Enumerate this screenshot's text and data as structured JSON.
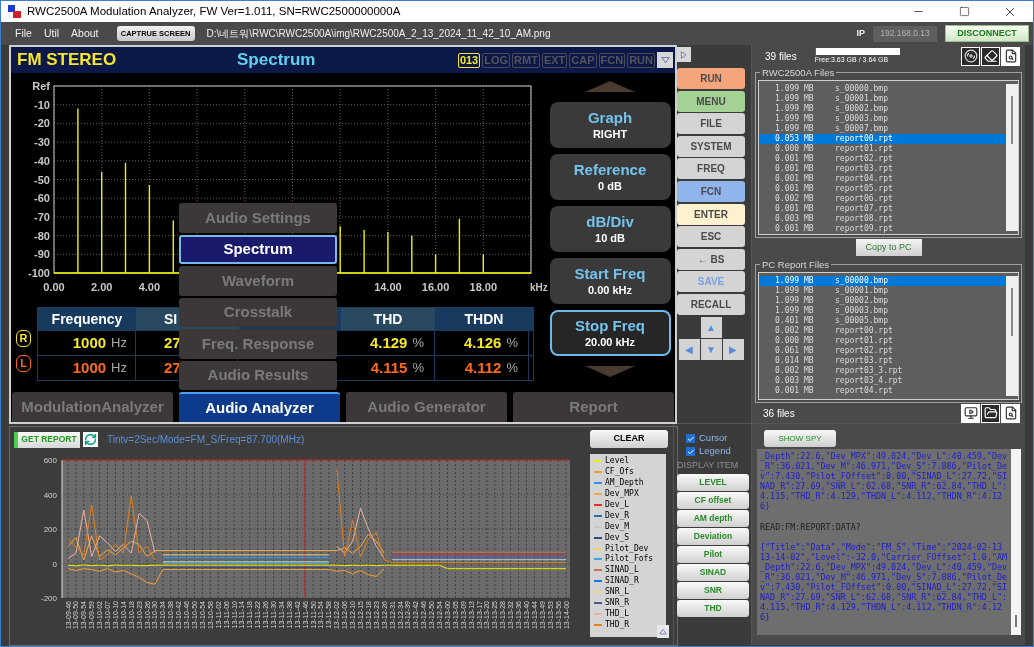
{
  "window": {
    "title": "RWC2500A Modulation Analyzer, FW Ver=1.011, SN=RWC2500000000A"
  },
  "menu": [
    "File",
    "Util",
    "About"
  ],
  "toolbar": {
    "capture_button": "CAPTRUE SCREEN",
    "path": "D:\\네트워\\RWC\\RWC2500A\\img\\RWC2500A_2_13_2024_11_42_10_AM.png",
    "ip_label": "IP",
    "ip_value": "192.168.0.13",
    "disconnect_button": "DISCONNECT"
  },
  "screen": {
    "mode": "FM STEREO",
    "view": "Spectrum",
    "indicators": [
      {
        "label": "013",
        "on": true
      },
      {
        "label": "LOG",
        "on": false
      },
      {
        "label": "RMT",
        "on": false
      },
      {
        "label": "EXT",
        "on": false
      },
      {
        "label": "CAP",
        "on": false
      },
      {
        "label": "FCN",
        "on": false
      },
      {
        "label": "RUN",
        "on": false
      }
    ],
    "chart_data": {
      "type": "line",
      "xlabel": "kHz",
      "grid": true,
      "x": [
        0,
        1,
        1,
        1,
        2,
        2,
        2,
        3,
        3,
        3,
        4,
        4,
        4,
        5,
        5,
        5,
        12,
        12,
        12,
        13,
        13,
        13,
        14,
        14,
        14,
        15,
        15,
        15,
        16,
        16,
        16,
        17,
        17,
        17,
        18,
        18,
        18,
        20
      ],
      "series": [
        {
          "color": "#f0f000",
          "values": [
            -100,
            -100,
            -12,
            -100,
            -100,
            -46,
            -100,
            -100,
            -41,
            -100,
            -100,
            -53,
            -100,
            -100,
            -72,
            -100,
            -100,
            -75,
            -100,
            -100,
            -77,
            -100,
            -100,
            -78,
            -100,
            -100,
            -80,
            -100,
            -100,
            -90,
            -100,
            -100,
            -71,
            -100,
            -100,
            -90,
            -100,
            -100
          ]
        }
      ],
      "xlim": [
        0,
        20
      ],
      "ylim": [
        -100,
        0
      ],
      "xticks": [
        {
          "value": 0,
          "label": "0.00"
        },
        {
          "value": 2,
          "label": "2.00"
        },
        {
          "value": 4,
          "label": "4.00"
        },
        {
          "value": 14,
          "label": "14.00"
        },
        {
          "value": 16,
          "label": "16.00"
        },
        {
          "value": 18,
          "label": "18.00"
        }
      ],
      "yticks": [
        {
          "value": 0,
          "label": "Ref"
        },
        -10,
        -20,
        -30,
        -40,
        -50,
        -60,
        -70,
        -80,
        -90,
        -100
      ]
    },
    "table": {
      "columns": [
        "Frequency",
        "SI",
        "THD",
        "THDN"
      ],
      "rows": [
        {
          "channel": "R",
          "color": "#f5e62a",
          "cells": [
            {
              "value": "1000",
              "unit": "Hz"
            },
            {
              "value": "27"
            },
            {
              "value": "4.129",
              "unit": "%"
            },
            {
              "value": "4.126",
              "unit": "%"
            }
          ]
        },
        {
          "channel": "L",
          "color": "#ff6a1a",
          "cells": [
            {
              "value": "1000",
              "unit": "Hz"
            },
            {
              "value": "27"
            },
            {
              "value": "4.115",
              "unit": "%"
            },
            {
              "value": "4.112",
              "unit": "%"
            }
          ]
        }
      ]
    },
    "popup_menu": [
      {
        "label": "Audio Settings",
        "selected": false
      },
      {
        "label": "Spectrum",
        "selected": true
      },
      {
        "label": "Waveform",
        "selected": false
      },
      {
        "label": "Crosstalk",
        "selected": false
      },
      {
        "label": "Freq. Response",
        "selected": false
      },
      {
        "label": "Audio Results",
        "selected": false
      }
    ],
    "soft_keys": [
      {
        "title": "Graph",
        "value": "RIGHT",
        "selected": false
      },
      {
        "title": "Reference",
        "value": "0 dB",
        "selected": false
      },
      {
        "title": "dB/Div",
        "value": "10 dB",
        "selected": false
      },
      {
        "title": "Start Freq",
        "value": "0.00 kHz",
        "selected": false
      },
      {
        "title": "Stop Freq",
        "value": "20.00 kHz",
        "selected": true
      }
    ],
    "tabs": [
      {
        "label": "ModulationAnalyzer",
        "selected": false
      },
      {
        "label": "Audio Analyzer",
        "selected": true
      },
      {
        "label": "Audio Generator",
        "selected": false
      },
      {
        "label": "Report",
        "selected": false
      }
    ]
  },
  "keys": [
    {
      "label": "RUN",
      "color": "#f4a57c",
      "disabled": false
    },
    {
      "label": "MENU",
      "color": "#a3d294",
      "disabled": false
    },
    {
      "label": "FILE",
      "color": "#d4d4d4",
      "disabled": false
    },
    {
      "label": "SYSTEM",
      "color": "#d4d4d4",
      "disabled": false
    },
    {
      "label": "FREQ",
      "color": "#d4d4d4",
      "disabled": false
    },
    {
      "label": "FCN",
      "color": "#8fb5ec",
      "disabled": false
    },
    {
      "label": "ENTER",
      "color": "#fdf1cf",
      "disabled": false
    },
    {
      "label": "ESC",
      "color": "#d4d4d4",
      "disabled": false
    },
    {
      "label": "← BS",
      "color": "#d4d4d4",
      "disabled": false
    },
    {
      "label": "SAVE",
      "color": "#d4d4d4",
      "disabled": true
    },
    {
      "label": "RECALL",
      "color": "#d4d4d4",
      "disabled": false
    }
  ],
  "arrow_keys": [
    "▲",
    "◀",
    "▼",
    "▶"
  ],
  "device_files": {
    "count": "39 files",
    "disk": {
      "level": 0.01,
      "free": "Free:3.63 GB / 3.64 GB"
    },
    "title": "RWC2500A Files",
    "rows": [
      {
        "size": "1.099 MB",
        "name": "s_00000.bmp",
        "selected": false
      },
      {
        "size": "1.099 MB",
        "name": "s_00001.bmp",
        "selected": false
      },
      {
        "size": "1.099 MB",
        "name": "s_00002.bmp",
        "selected": false
      },
      {
        "size": "1.099 MB",
        "name": "s_00003.bmp",
        "selected": false
      },
      {
        "size": "1.099 MB",
        "name": "s_00007.bmp",
        "selected": false
      },
      {
        "size": "0.053 MB",
        "name": "report00.rpt",
        "selected": true
      },
      {
        "size": "0.000 MB",
        "name": "report01.rpt",
        "selected": false
      },
      {
        "size": "0.001 MB",
        "name": "report02.rpt",
        "selected": false
      },
      {
        "size": "0.001 MB",
        "name": "report03.rpt",
        "selected": false
      },
      {
        "size": "0.001 MB",
        "name": "report04.rpt",
        "selected": false
      },
      {
        "size": "0.001 MB",
        "name": "report05.rpt",
        "selected": false
      },
      {
        "size": "0.002 MB",
        "name": "report06.rpt",
        "selected": false
      },
      {
        "size": "0.001 MB",
        "name": "report07.rpt",
        "selected": false
      },
      {
        "size": "0.003 MB",
        "name": "report08.rpt",
        "selected": false
      },
      {
        "size": "0.001 MB",
        "name": "report09.rpt",
        "selected": false
      }
    ]
  },
  "copy_button": "Copy to PC",
  "pc_files": {
    "title": "PC Report Files",
    "count": "36 files",
    "rows": [
      {
        "size": "1.099 MB",
        "name": "s_00000.bmp",
        "selected": true
      },
      {
        "size": "1.099 MB",
        "name": "s_00001.bmp",
        "selected": false
      },
      {
        "size": "1.099 MB",
        "name": "s_00002.bmp",
        "selected": false
      },
      {
        "size": "1.099 MB",
        "name": "s_00003.bmp",
        "selected": false
      },
      {
        "size": "0.401 MB",
        "name": "s_00005.bmp",
        "selected": false
      },
      {
        "size": "0.002 MB",
        "name": "report00.rpt",
        "selected": false
      },
      {
        "size": "0.000 MB",
        "name": "report01.rpt",
        "selected": false
      },
      {
        "size": "0.061 MB",
        "name": "report02.rpt",
        "selected": false
      },
      {
        "size": "0.014 MB",
        "name": "report03.rpt",
        "selected": false
      },
      {
        "size": "0.002 MB",
        "name": "report03_3.rpt",
        "selected": false
      },
      {
        "size": "0.003 MB",
        "name": "report03_4.rpt",
        "selected": false
      },
      {
        "size": "0.001 MB",
        "name": "report04.rpt",
        "selected": false
      }
    ]
  },
  "report": {
    "get_button": "GET REPORT",
    "info": "Tintv=2Sec/Mode=FM_S/Freq=87.700(MHz)",
    "clear_button": "CLEAR",
    "chart_data": {
      "type": "line",
      "grid": true,
      "ylim": [
        -200,
        600
      ],
      "yticks": [
        -200,
        0,
        200,
        400,
        600
      ],
      "categories": [
        "13-09-46",
        "13-09-50",
        "13-09-54",
        "13-09-59",
        "13-10-02",
        "13-10-07",
        "13-10-10",
        "13-10-14",
        "13-10-18",
        "13-10-23",
        "13-10-26",
        "13-10-30",
        "13-10-34",
        "13-10-38",
        "13-10-42",
        "13-10-46",
        "13-10-50",
        "13-10-54",
        "13-10-58",
        "13-11-02",
        "13-11-06",
        "13-11-10",
        "13-11-14",
        "13-11-18",
        "13-11-22",
        "13-11-26",
        "13-11-30",
        "13-11-34",
        "13-11-38",
        "13-11-42",
        "13-11-46",
        "13-11-50",
        "13-11-54",
        "13-11-58",
        "13-12-02",
        "13-12-06",
        "13-12-10",
        "13-12-15",
        "13-12-18",
        "13-12-23",
        "13-12-26",
        "13-12-31",
        "13-12-34",
        "13-12-39",
        "13-12-42",
        "13-12-46",
        "13-12-50",
        "13-12-54",
        "13-13-00",
        "13-13-05",
        "13-13-09",
        "13-13-13",
        "13-13-17",
        "13-13-20",
        "13-13-25",
        "13-13-28",
        "13-13-32",
        "13-13-36",
        "13-13-40",
        "13-13-44",
        "13-13-49",
        "13-13-53",
        "13-13-56",
        "13-14-00"
      ],
      "ref_lines": [
        {
          "axis": "x",
          "value": "13-11-46"
        },
        {
          "axis": "y",
          "value": 600
        }
      ],
      "series": [
        {
          "name": "Level",
          "color": "#f0f000",
          "values": [
            -10,
            -14,
            -8,
            -12,
            -10,
            -14,
            -9,
            -11,
            -10,
            -13,
            -12,
            -10,
            -10,
            -10,
            -10,
            -10,
            -10,
            -10,
            -10,
            -10,
            -10,
            -10,
            -10,
            -10,
            -10,
            -10,
            -10,
            -10,
            -10,
            -10,
            -10,
            -10,
            -10,
            -10,
            -10,
            -12,
            -10,
            -11,
            -10,
            -12,
            -10,
            -10,
            -10,
            -10,
            -10,
            -10,
            -10,
            -10,
            -30,
            -30,
            -30,
            -30,
            -30,
            -30,
            -30,
            -30,
            -30,
            -30,
            -30,
            -30,
            -30,
            -30,
            -30,
            -30
          ]
        },
        {
          "name": "CF_Ofs",
          "color": "#f5a030",
          "values": [
            -30,
            -40,
            -30,
            -35,
            -45,
            -30,
            -50,
            -40,
            -60,
            -80,
            -110,
            -120,
            -35,
            -35,
            -35,
            -35,
            -35,
            -35,
            -35,
            -35,
            -35,
            -35,
            -35,
            -35,
            -35,
            -35,
            -35,
            -35,
            -35,
            -35,
            -35,
            -35,
            -35,
            -35,
            -45,
            -40,
            -60,
            -40,
            -65,
            -75,
            -30,
            null,
            null,
            null,
            null,
            null,
            null,
            null,
            null,
            null,
            null,
            null,
            null,
            null,
            null,
            null,
            null,
            null,
            null,
            null,
            null,
            null,
            null,
            null
          ]
        },
        {
          "name": "AM_Depth",
          "color": "#3a8ee8",
          "values": [
            null,
            null,
            null,
            null,
            null,
            null,
            null,
            null,
            null,
            null,
            null,
            null,
            35,
            35,
            35,
            35,
            35,
            35,
            35,
            35,
            35,
            35,
            35,
            35,
            35,
            35,
            35,
            35,
            35,
            35,
            35,
            35,
            35,
            35,
            null,
            null,
            null,
            null,
            null,
            null,
            null,
            null,
            null,
            null,
            null,
            null,
            null,
            null,
            null,
            null,
            null,
            null,
            null,
            null,
            null,
            null,
            null,
            null,
            null,
            null,
            null,
            null,
            null,
            null
          ]
        },
        {
          "name": "Dev_MPX",
          "color": "#f0a848",
          "values": [
            100,
            150,
            20,
            160,
            40,
            80,
            50,
            90,
            130,
            110,
            40,
            75,
            75,
            75,
            75,
            75,
            75,
            75,
            75,
            75,
            75,
            75,
            75,
            75,
            75,
            75,
            75,
            75,
            75,
            75,
            75,
            75,
            75,
            75,
            75,
            90,
            60,
            100,
            170,
            130,
            60,
            null,
            null,
            null,
            null,
            null,
            null,
            null,
            null,
            null,
            null,
            null,
            null,
            null,
            null,
            null,
            null,
            null,
            null,
            null,
            null,
            null,
            null,
            null
          ]
        },
        {
          "name": "Dev_L",
          "color": "#e03020",
          "values": [
            null,
            null,
            null,
            null,
            null,
            null,
            null,
            null,
            null,
            null,
            null,
            null,
            null,
            null,
            null,
            null,
            null,
            null,
            null,
            null,
            null,
            null,
            null,
            null,
            null,
            null,
            null,
            null,
            null,
            null,
            null,
            null,
            null,
            null,
            null,
            null,
            null,
            null,
            null,
            null,
            null,
            44,
            44,
            44,
            44,
            44,
            44,
            44,
            44,
            44,
            44,
            44,
            44,
            44,
            44,
            44,
            44,
            44,
            44,
            44,
            44,
            44,
            44,
            44
          ]
        },
        {
          "name": "Dev_R",
          "color": "#2070b0",
          "values": [
            null,
            null,
            null,
            null,
            null,
            null,
            null,
            null,
            null,
            null,
            null,
            null,
            20,
            20,
            20,
            20,
            20,
            20,
            20,
            20,
            20,
            20,
            20,
            20,
            20,
            20,
            20,
            20,
            20,
            20,
            20,
            20,
            20,
            20,
            null,
            null,
            null,
            null,
            null,
            null,
            null,
            null,
            null,
            null,
            null,
            null,
            null,
            null,
            null,
            null,
            null,
            null,
            null,
            null,
            null,
            null,
            null,
            null,
            null,
            null,
            null,
            null,
            null,
            null
          ]
        },
        {
          "name": "Dev_M",
          "color": "#c8c8c8",
          "values": [
            null,
            null,
            null,
            null,
            null,
            null,
            null,
            null,
            null,
            null,
            null,
            null,
            null,
            null,
            null,
            null,
            null,
            null,
            null,
            null,
            null,
            null,
            null,
            null,
            null,
            null,
            null,
            null,
            null,
            null,
            null,
            null,
            null,
            null,
            null,
            null,
            null,
            null,
            null,
            null,
            null,
            22,
            22,
            22,
            22,
            22,
            22,
            22,
            22,
            22,
            22,
            22,
            22,
            22,
            22,
            22,
            22,
            22,
            22,
            22,
            22,
            22,
            22,
            22
          ]
        },
        {
          "name": "Dev_S",
          "color": "#2a4a8a",
          "values": [
            null,
            null,
            null,
            null,
            null,
            null,
            null,
            null,
            null,
            null,
            null,
            null,
            -22,
            -22,
            -22,
            -22,
            -22,
            -22,
            -22,
            -22,
            -22,
            -22,
            -22,
            -22,
            -22,
            -22,
            -22,
            -22,
            -22,
            -22,
            -22,
            -22,
            -22,
            -22,
            null,
            null,
            null,
            null,
            null,
            null,
            null,
            null,
            null,
            null,
            null,
            null,
            null,
            null,
            null,
            null,
            null,
            null,
            null,
            null,
            null,
            null,
            null,
            null,
            null,
            null,
            null,
            null,
            null,
            null
          ]
        },
        {
          "name": "Pilot_Dev",
          "color": "#f0d070",
          "values": [
            null,
            null,
            null,
            null,
            null,
            null,
            null,
            null,
            null,
            null,
            null,
            null,
            50,
            50,
            50,
            50,
            50,
            50,
            50,
            50,
            50,
            50,
            50,
            50,
            50,
            50,
            50,
            50,
            50,
            50,
            50,
            50,
            50,
            50,
            null,
            null,
            null,
            null,
            null,
            null,
            null,
            null,
            null,
            null,
            null,
            null,
            null,
            null,
            null,
            null,
            null,
            null,
            null,
            null,
            null,
            null,
            null,
            null,
            null,
            null,
            null,
            null,
            null,
            null
          ]
        },
        {
          "name": "Pilot_Fofs",
          "color": "#40a0e0",
          "values": [
            null,
            null,
            null,
            null,
            null,
            null,
            null,
            null,
            null,
            null,
            null,
            null,
            0,
            0,
            0,
            0,
            0,
            0,
            0,
            0,
            0,
            0,
            0,
            0,
            0,
            0,
            0,
            0,
            0,
            0,
            0,
            0,
            0,
            0,
            null,
            null,
            null,
            null,
            null,
            null,
            null,
            null,
            null,
            null,
            null,
            null,
            null,
            null,
            null,
            null,
            null,
            null,
            null,
            null,
            null,
            null,
            null,
            null,
            null,
            null,
            null,
            null,
            null,
            null
          ]
        },
        {
          "name": "SINAD_L",
          "color": "#d07050",
          "values": [
            null,
            null,
            null,
            null,
            null,
            null,
            null,
            null,
            null,
            null,
            null,
            null,
            null,
            null,
            null,
            null,
            null,
            null,
            null,
            null,
            null,
            null,
            null,
            null,
            null,
            null,
            null,
            null,
            null,
            null,
            null,
            null,
            null,
            null,
            null,
            null,
            null,
            null,
            null,
            null,
            null,
            65,
            65,
            65,
            65,
            65,
            65,
            65,
            65,
            65,
            65,
            65,
            65,
            65,
            65,
            65,
            65,
            65,
            65,
            65,
            65,
            65,
            65,
            65
          ]
        },
        {
          "name": "SINAD_R",
          "color": "#1a70e0",
          "values": [
            null,
            null,
            null,
            null,
            null,
            null,
            null,
            null,
            null,
            null,
            null,
            null,
            null,
            null,
            null,
            null,
            null,
            null,
            null,
            null,
            null,
            null,
            null,
            null,
            null,
            null,
            null,
            null,
            null,
            null,
            null,
            null,
            null,
            null,
            null,
            null,
            null,
            null,
            null,
            null,
            null,
            33,
            33,
            33,
            33,
            33,
            33,
            33,
            33,
            33,
            33,
            33,
            33,
            33,
            33,
            33,
            33,
            33,
            33,
            33,
            33,
            33,
            33,
            33
          ]
        },
        {
          "name": "SNR_L",
          "color": "#f0d890",
          "values": [
            null,
            null,
            null,
            null,
            null,
            null,
            null,
            null,
            null,
            null,
            null,
            null,
            10,
            10,
            10,
            10,
            10,
            10,
            10,
            10,
            10,
            10,
            10,
            10,
            10,
            10,
            10,
            10,
            10,
            10,
            10,
            10,
            10,
            10,
            null,
            null,
            null,
            null,
            null,
            null,
            null,
            null,
            null,
            null,
            null,
            null,
            null,
            null,
            null,
            null,
            null,
            null,
            null,
            null,
            null,
            null,
            null,
            null,
            null,
            null,
            null,
            null,
            null,
            null
          ]
        },
        {
          "name": "SNR_R",
          "color": "#4a5a7a",
          "values": [
            null,
            null,
            null,
            null,
            null,
            null,
            null,
            null,
            null,
            null,
            null,
            null,
            null,
            null,
            null,
            null,
            null,
            null,
            null,
            null,
            null,
            null,
            null,
            null,
            null,
            null,
            null,
            null,
            null,
            null,
            null,
            null,
            null,
            null,
            null,
            null,
            null,
            null,
            null,
            null,
            null,
            55,
            55,
            55,
            55,
            55,
            55,
            55,
            55,
            55,
            55,
            55,
            55,
            55,
            55,
            55,
            55,
            55,
            55,
            55,
            55,
            55,
            55,
            55
          ]
        },
        {
          "name": "THD_L",
          "color": "#f0b0a0",
          "values": [
            30,
            60,
            310,
            40,
            160,
            120,
            70,
            110,
            60,
            290,
            250,
            60,
            null,
            null,
            null,
            null,
            null,
            null,
            null,
            null,
            null,
            null,
            null,
            null,
            null,
            null,
            null,
            null,
            null,
            null,
            null,
            null,
            null,
            null,
            100,
            60,
            130,
            320,
            200,
            100,
            30,
            null,
            null,
            null,
            null,
            null,
            null,
            null,
            null,
            null,
            null,
            null,
            null,
            null,
            null,
            null,
            null,
            null,
            null,
            null,
            null,
            null,
            null,
            null
          ]
        },
        {
          "name": "THD_R",
          "color": "#e08020",
          "values": [
            140,
            100,
            50,
            340,
            20,
            50,
            110,
            60,
            390,
            60,
            100,
            20,
            null,
            null,
            null,
            null,
            null,
            null,
            null,
            null,
            null,
            null,
            null,
            null,
            null,
            null,
            null,
            null,
            null,
            null,
            null,
            null,
            null,
            null,
            550,
            40,
            250,
            40,
            140,
            180,
            20,
            5,
            5,
            5,
            5,
            5,
            5,
            5,
            5,
            5,
            5,
            5,
            5,
            5,
            5,
            5,
            5,
            5,
            5,
            5,
            5,
            5,
            5,
            5
          ]
        }
      ]
    }
  },
  "display": {
    "options": [
      {
        "label": "Cursor",
        "checked": true
      },
      {
        "label": "Legend",
        "checked": true
      }
    ],
    "heading": "DISPLAY ITEM",
    "items": [
      "LEVEL",
      "CF offset",
      "AM depth",
      "Deviation",
      "Pilot",
      "SINAD",
      "SNR",
      "THD"
    ]
  },
  "spy": {
    "button": "SHOW SPY",
    "log": [
      {
        "kind": "response",
        "text": "_Depth\":22.6,\"Dev_MPX\":49.024,\"Dev_L\":40.459,\"Dev_R\":36.021,\"Dev_M\":46.971,\"Dev_S\":7.886,\"Pilot_Dev\":7.430,\"Pilot_FOffset\":0.00,\"SINAD_L\":27.72,\"SINAD_R\":27.69,\"SNR_L\":62.68,\"SNR_R\":62.84,\"THD_L\":4.115,\"THD_R\":4.129,\"THDN_L\":4.112,\"THDN_R\":4.126}"
      },
      {
        "kind": "command",
        "text": "READ:FM:REPORT:DATA?"
      },
      {
        "kind": "response",
        "text": "{\"Title\":\"Data\",\"Mode\":\"FM_S\",\"Time\":\"2024-02-13 13-14-02\",\"Level\":-32.0,\"Carrier_FOffset\":1.0,\"AM_Depth\":22.6,\"Dev_MPX\":49.024,\"Dev_L\":40.459,\"Dev_R\":36.021,\"Dev_M\":46.971,\"Dev_S\":7.886,\"Pilot_Dev\":7.430,\"Pilot_FOffset\":0.00,\"SINAD_L\":27.72,\"SINAD_R\":27.69,\"SNR_L\":62.68,\"SNR_R\":62.84,\"THD_L\":4.115,\"THD_R\":4.129,\"THDN_L\":4.112,\"THDN_R\":4.126}"
      }
    ]
  }
}
